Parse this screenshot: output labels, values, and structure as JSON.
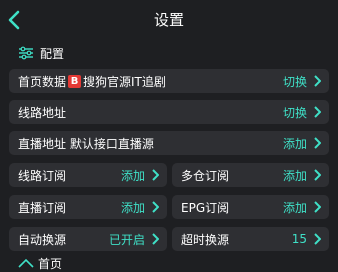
{
  "header": {
    "title": "设置"
  },
  "section": {
    "label": "配置"
  },
  "rows": [
    {
      "pre": "首页数据",
      "badge": "B",
      "post": "搜狗官源IT追剧",
      "value": "切换"
    },
    {
      "label": "线路地址",
      "value": "切换"
    },
    {
      "label": "直播地址 默认接口直播源",
      "value": "添加"
    }
  ],
  "grid": [
    {
      "label": "线路订阅",
      "value": "添加"
    },
    {
      "label": "多仓订阅",
      "value": "添加"
    },
    {
      "label": "直播订阅",
      "value": "添加"
    },
    {
      "label": "EPG订阅",
      "value": "添加"
    },
    {
      "label": "自动换源",
      "value": "已开启"
    },
    {
      "label": "超时换源",
      "value": "15"
    }
  ],
  "footer": {
    "label": "首页"
  },
  "colors": {
    "accent": "#3fe0c7",
    "background": "#1e1f22",
    "card": "#2e2f33",
    "badge": "#e53935"
  }
}
